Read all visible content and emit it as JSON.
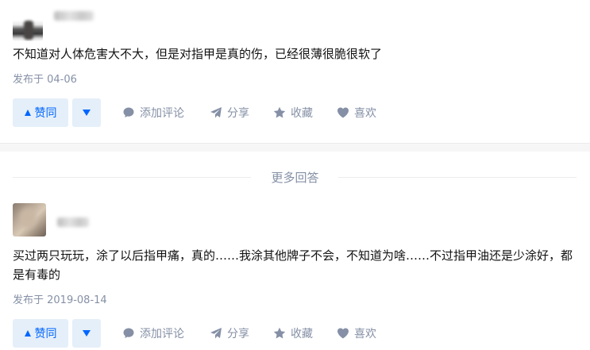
{
  "answers": [
    {
      "content": "不知道对人体危害大不大，但是对指甲是真的伤，已经很薄很脆很软了",
      "published": "发布于 04-06",
      "actions": {
        "vote_up": "赞同",
        "comment": "添加评论",
        "share": "分享",
        "collect": "收藏",
        "like": "喜欢"
      }
    },
    {
      "content": "买过两只玩玩，涂了以后指甲痛，真的……我涂其他牌子不会，不知道为啥……不过指甲油还是少涂好，都是有毒的",
      "published": "发布于 2019-08-14",
      "actions": {
        "vote_up": "赞同",
        "comment": "添加评论",
        "share": "分享",
        "collect": "收藏",
        "like": "喜欢"
      }
    }
  ],
  "more_answers_label": "更多回答",
  "colors": {
    "accent": "#0066ff",
    "accent_bg": "#e5eff9",
    "meta": "#8590a6",
    "text": "#121212",
    "divider": "#f6f6f6"
  },
  "icons": [
    "caret-up-icon",
    "caret-down-icon",
    "comment-icon",
    "share-icon",
    "star-icon",
    "heart-icon"
  ]
}
